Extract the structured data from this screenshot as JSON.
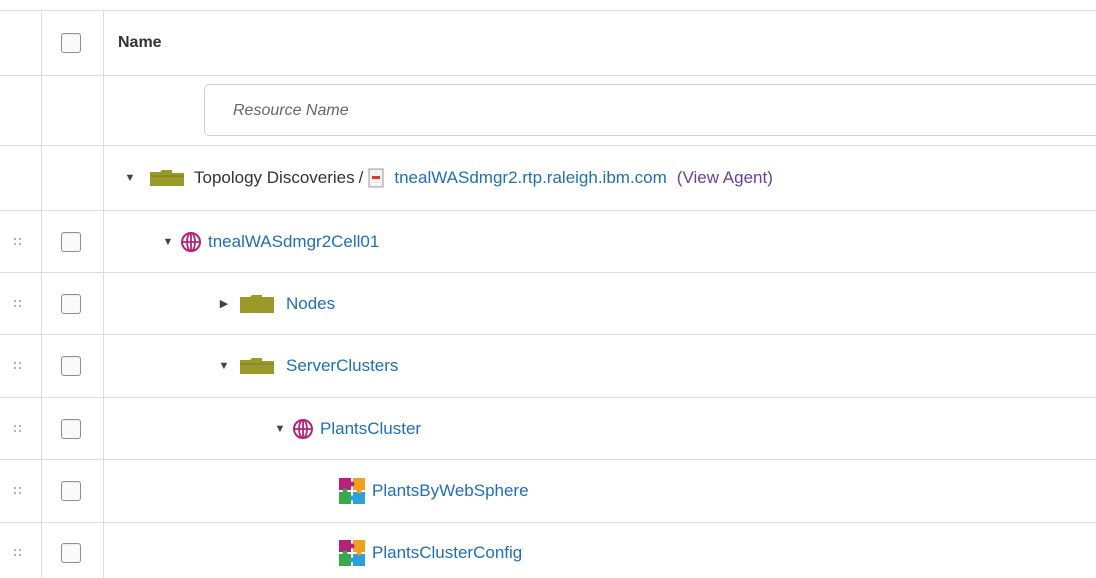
{
  "table": {
    "header": {
      "name_label": "Name"
    },
    "filter": {
      "placeholder": "Resource Name"
    },
    "breadcrumb": {
      "root_label": "Topology Discoveries",
      "separator": "/",
      "agent_label": "tnealWASdmgr2.rtp.raleigh.ibm.com",
      "view_agent_label": "(View Agent)"
    },
    "rows": [
      {
        "label": "tnealWASdmgr2Cell01",
        "icon": "globe-icon",
        "toggle": "expanded"
      },
      {
        "label": "Nodes",
        "icon": "folder-closed-icon",
        "toggle": "collapsed"
      },
      {
        "label": "ServerClusters",
        "icon": "folder-open-icon",
        "toggle": "expanded"
      },
      {
        "label": "PlantsCluster",
        "icon": "globe-icon",
        "toggle": "expanded"
      },
      {
        "label": "PlantsByWebSphere",
        "icon": "application-puzzle-icon",
        "toggle": "none"
      },
      {
        "label": "PlantsClusterConfig",
        "icon": "application-puzzle-icon",
        "toggle": "none"
      }
    ]
  },
  "colors": {
    "link": "#1e6fb3",
    "view_agent": "#6a3f9c",
    "folder": "#9a9a2a",
    "globe": "#b5227a",
    "border": "#dcdcdc"
  }
}
